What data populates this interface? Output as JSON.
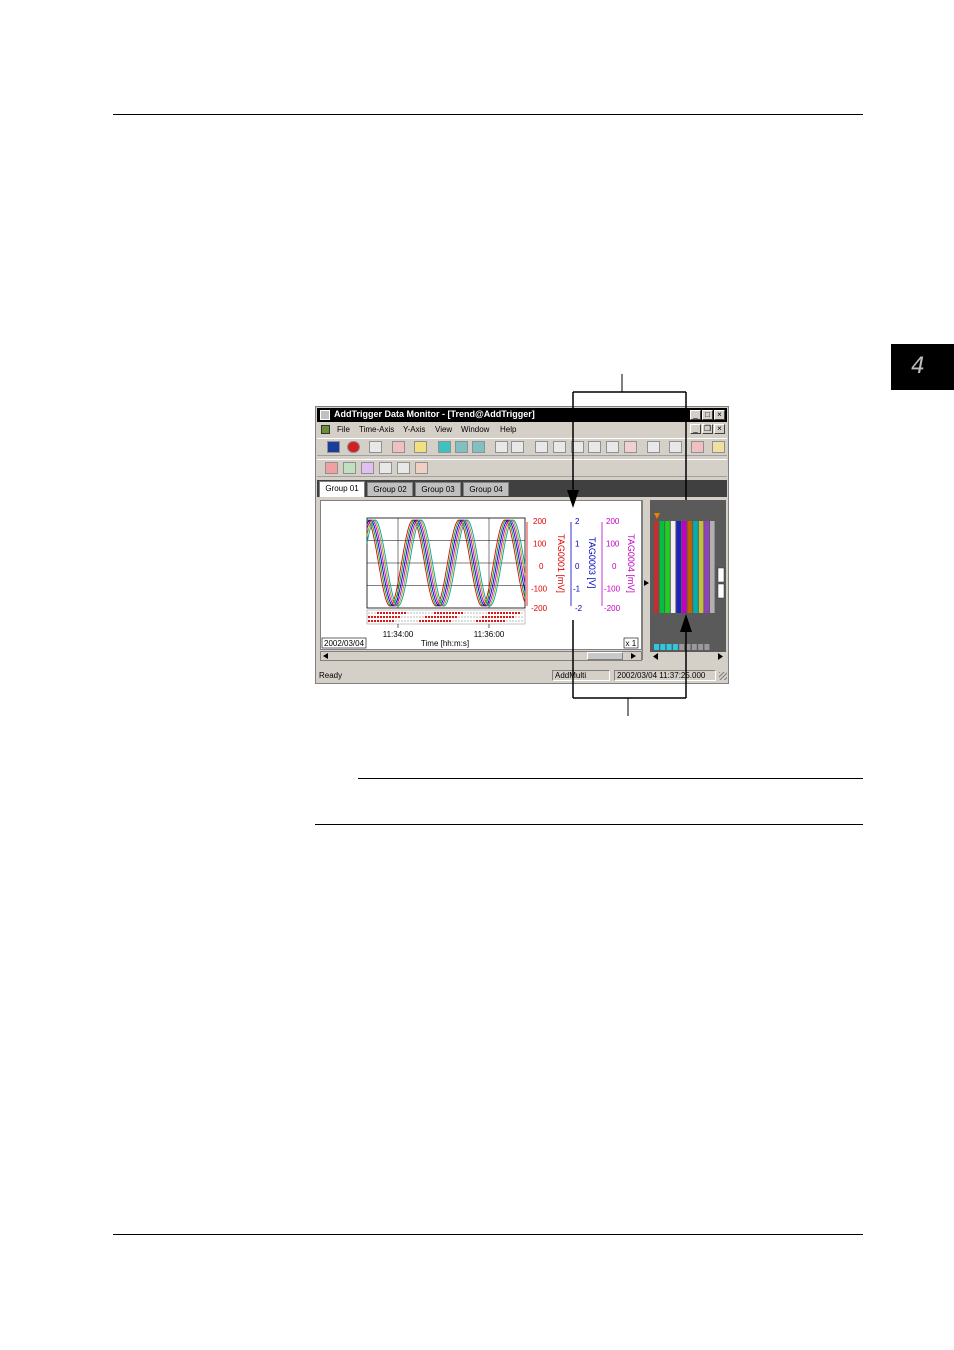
{
  "chapter": {
    "number": "4"
  },
  "window": {
    "title": "AddTrigger Data Monitor - [Trend@AddTrigger]",
    "menu": [
      "File",
      "Time-Axis",
      "Y-Axis",
      "View",
      "Window",
      "Help"
    ],
    "tabs": [
      "Group 01",
      "Group 02",
      "Group 03",
      "Group 04"
    ],
    "active_tab": "Group 01"
  },
  "trend": {
    "date": "2002/03/04",
    "time_ticks": [
      "11:34:00",
      "11:36:00"
    ],
    "time_axis_label": "Time [hh:m:s]",
    "zoom": "x 1",
    "scales": [
      {
        "tag": "TAG0001 [mV]",
        "ticks": [
          "200",
          "100",
          "0",
          "-100",
          "-200"
        ],
        "color": "#e00000"
      },
      {
        "tag": "TAG0003 [V]",
        "ticks": [
          "2",
          "1",
          "0",
          "-1",
          "-2"
        ],
        "color": "#0000c0"
      },
      {
        "tag": "TAG0004 [mV]",
        "ticks": [
          "200",
          "100",
          "0",
          "-100",
          "-200"
        ],
        "color": "#c000c0"
      }
    ],
    "series_colors": [
      "#e00000",
      "#00a000",
      "#0000e0",
      "#c000c0",
      "#a0a000",
      "#00a0a0"
    ]
  },
  "statusbar": {
    "ready": "Ready",
    "mode": "AddMulti",
    "datetime": "2002/03/04 11:37:25.000"
  }
}
